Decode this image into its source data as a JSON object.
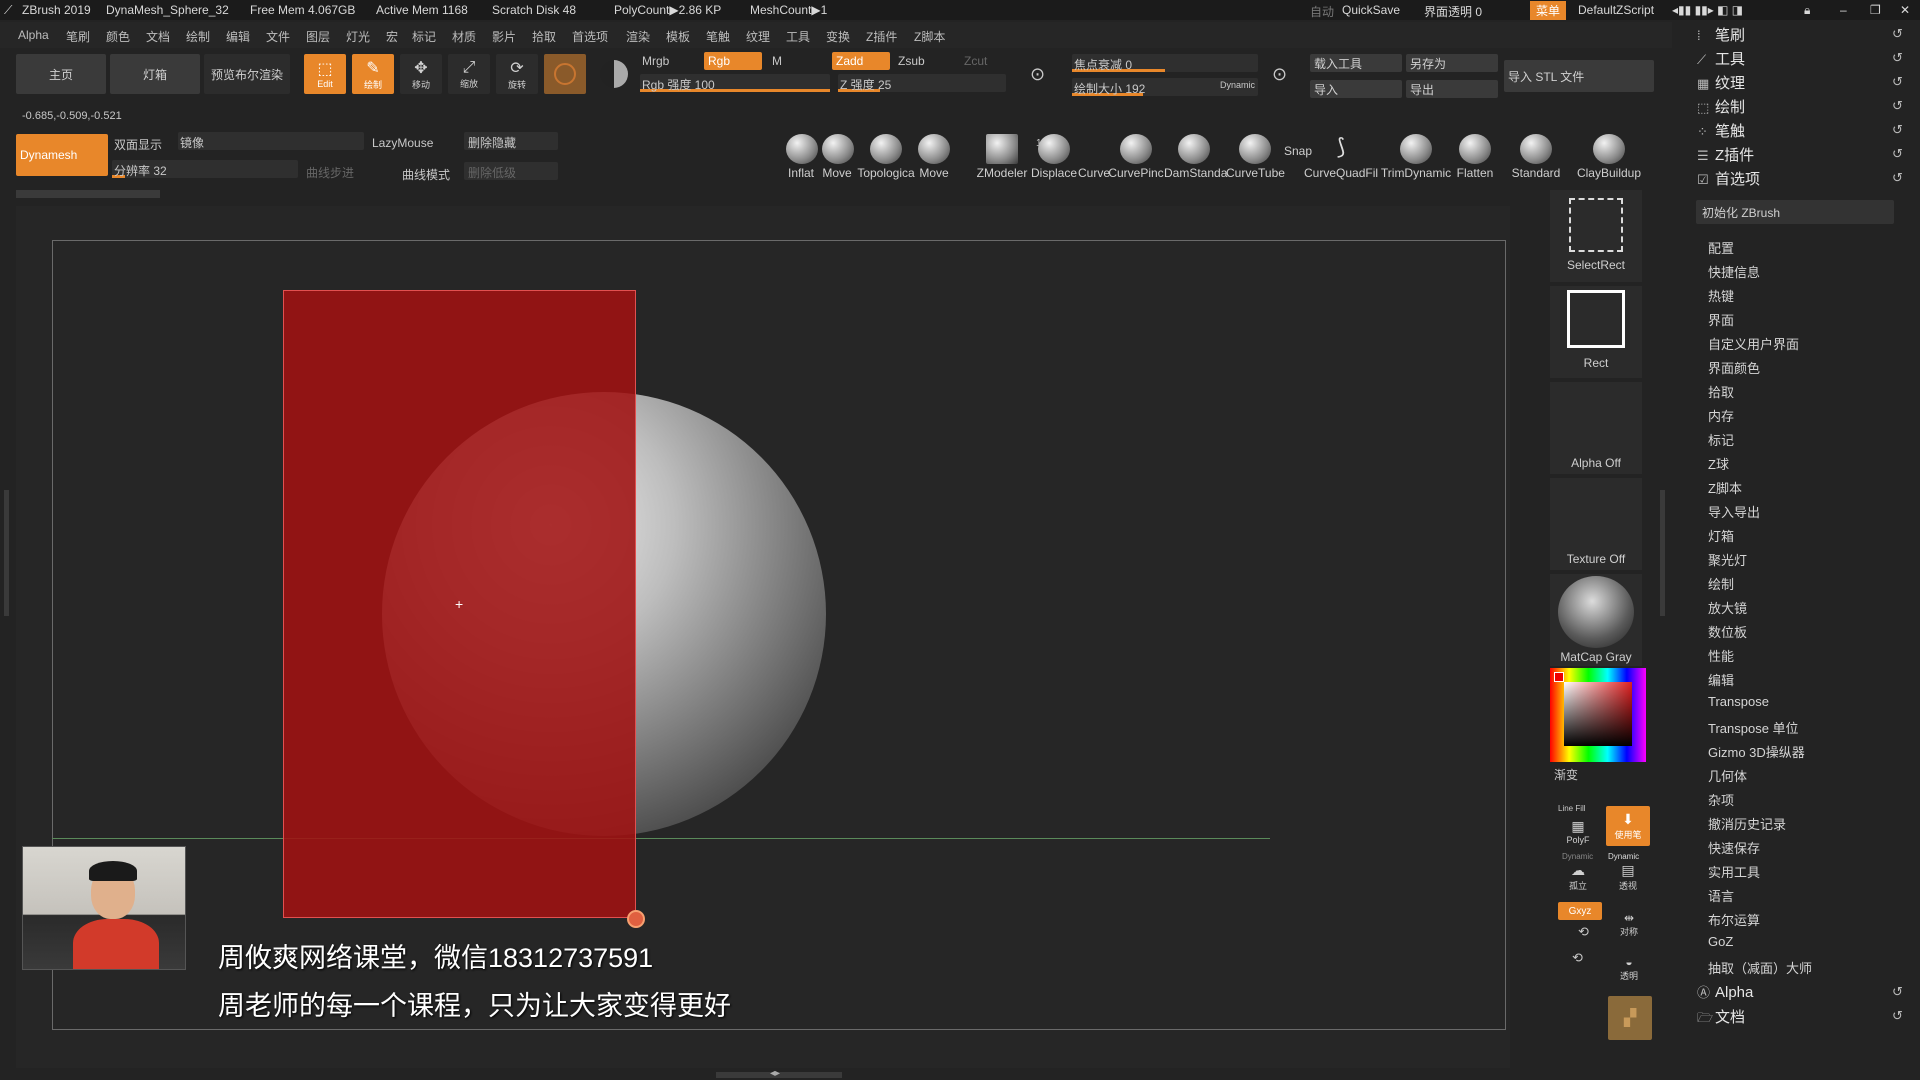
{
  "titlebar": {
    "app": "ZBrush 2019",
    "doc": "DynaMesh_Sphere_32",
    "free_mem": "Free Mem 4.067GB",
    "active_mem": "Active Mem 1168",
    "scratch": "Scratch Disk 48",
    "polycount": "PolyCount▶2.86 KP",
    "meshcount": "MeshCount▶1",
    "auto": "自动",
    "quicksave": "QuickSave",
    "transparency": "界面透明 0",
    "menu": "菜单",
    "script": "DefaultZScript"
  },
  "menus": [
    "Alpha",
    "笔刷",
    "颜色",
    "文档",
    "绘制",
    "编辑",
    "文件",
    "图层",
    "灯光",
    "宏",
    "标记",
    "材质",
    "影片",
    "拾取",
    "首选项",
    "渲染",
    "模板",
    "笔触",
    "纹理",
    "工具",
    "变换",
    "Z插件",
    "Z脚本"
  ],
  "toolbar": {
    "home": "主页",
    "lightbox": "灯箱",
    "bpr": "预览布尔渲染",
    "edit": "Edit",
    "draw": "绘制",
    "move": "移动",
    "scale": "缩放",
    "rotate": "旋转",
    "mrgb": "Mrgb",
    "rgb": "Rgb",
    "m": "M",
    "zadd": "Zadd",
    "zsub": "Zsub",
    "zcut": "Zcut",
    "rgb_intensity": "Rgb 强度 100",
    "z_intensity": "Z 强度 25",
    "focal": "焦点衰减 0",
    "draw_size": "绘制大小 192",
    "dynamic": "Dynamic",
    "load_tool": "载入工具",
    "save_as": "另存为",
    "import": "导入",
    "export": "导出",
    "import_stl": "导入 STL 文件",
    "coords": "-0.685,-0.509,-0.521"
  },
  "dyna": {
    "dynamesh": "Dynamesh",
    "double": "双面显示",
    "mirror": "镜像",
    "lazymouse": "LazyMouse",
    "del_hidden": "删除隐藏",
    "resolution": "分辨率 32",
    "curve_step": "曲线步进",
    "curve_mode": "曲线模式",
    "del_lower": "删除低级"
  },
  "brushes": [
    "Inflat",
    "Move",
    "Topologica",
    "Move",
    "ZModeler",
    "Displace",
    "Curve",
    "CurvePinc",
    "DamStanda",
    "CurveTube",
    "Snap",
    "CurveQuadFil",
    "TrimDynamic",
    "Flatten",
    "Standard",
    "ClayBuildup"
  ],
  "brush_count": "1",
  "right_tiles": {
    "selectrect": "SelectRect",
    "rect": "Rect",
    "alpha": "Alpha Off",
    "texture": "Texture Off",
    "matcap": "MatCap Gray",
    "gradient": "渐变"
  },
  "side_icons": {
    "polyf": "PolyF",
    "linefill": "Line Fill",
    "usebrush": "使用笔",
    "solo": "孤立",
    "persp": "透视",
    "dyn1": "Dynamic",
    "dyn2": "Dynamic",
    "xyz": "Gxyz",
    "sym": "对称",
    "transp": "透明"
  },
  "right_panel": {
    "headers": [
      "笔刷",
      "工具",
      "纹理",
      "绘制",
      "笔触",
      "Z插件",
      "首选项"
    ],
    "init": "初始化 ZBrush",
    "items": [
      "配置",
      "快捷信息",
      "热键",
      "界面",
      "自定义用户界面",
      "界面颜色",
      "拾取",
      "内存",
      "标记",
      "Z球",
      "Z脚本",
      "导入导出",
      "灯箱",
      "聚光灯",
      "绘制",
      "放大镜",
      "数位板",
      "性能",
      "编辑",
      "Transpose",
      "Transpose 单位",
      "Gizmo 3D操纵器",
      "几何体",
      "杂项",
      "撤消历史记录",
      "快速保存",
      "实用工具",
      "语言",
      "布尔运算",
      "GoZ",
      "抽取（减面）大师"
    ],
    "footer": [
      "Alpha",
      "文档"
    ]
  },
  "subtitles": [
    "周攸爽网络课堂，微信18312737591",
    "周老师的每一个课程，只为让大家变得更好"
  ],
  "colors": {
    "accent": "#e8872a",
    "mask_red": "#9e1b1b",
    "bg": "#232323"
  }
}
